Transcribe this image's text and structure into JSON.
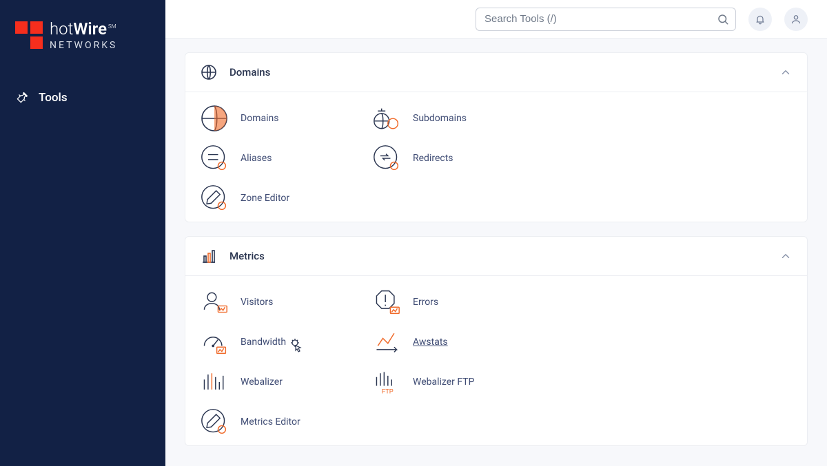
{
  "brand": {
    "name_html": "hotWire",
    "sm": "SM",
    "sub": "NETWORKS"
  },
  "sidebar": {
    "items": [
      {
        "label": "Tools"
      }
    ]
  },
  "search": {
    "placeholder": "Search Tools (/)"
  },
  "panels": {
    "domains": {
      "title": "Domains",
      "items": [
        {
          "label": "Domains"
        },
        {
          "label": "Subdomains"
        },
        {
          "label": "Aliases"
        },
        {
          "label": "Redirects"
        },
        {
          "label": "Zone Editor"
        }
      ]
    },
    "metrics": {
      "title": "Metrics",
      "items": [
        {
          "label": "Visitors"
        },
        {
          "label": "Errors"
        },
        {
          "label": "Bandwidth"
        },
        {
          "label": "Awstats"
        },
        {
          "label": "Webalizer"
        },
        {
          "label": "Webalizer FTP"
        },
        {
          "label": "Metrics Editor"
        }
      ]
    }
  },
  "ftp_text": "FTP"
}
